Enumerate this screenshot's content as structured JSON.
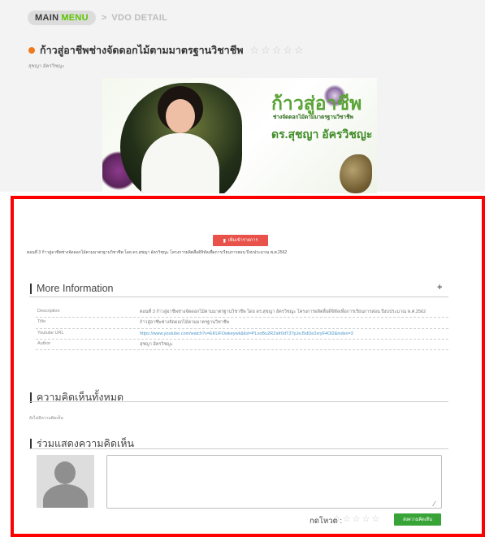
{
  "breadcrumb": {
    "main": "MAIN",
    "menu": "MENU",
    "separator": ">",
    "current": "VDO DETAIL"
  },
  "video": {
    "title": "ก้าวสู่อาชีพช่างจัดดอกไม้ตามมาตรฐานวิชาชีพ",
    "stars": "☆☆☆☆☆",
    "author_sub": "สุชญา อัครวิชญะ"
  },
  "banner": {
    "title": "ก้าวสู่อาชีพ",
    "subtitle": "ช่างจัดดอกไม้ตามมาตรฐานวิชาชีพ",
    "name": "ดร.สุชญา อัครวิชญะ"
  },
  "actions": {
    "bookmark_label": "เพิ่มเข้ารายการ"
  },
  "episode_desc": "ตอนที่ 3 ก้าวสู่อาชีพช่างจัดดอกไม้ตามมาตรฐานวิชาชีพ โดย ดร.สุชญา อัครวิชญะ โครงการผลิตสื่อดิจิทัลเพื่อการเรียนการสอน ปีงบประมาณ พ.ศ.2562",
  "more_info": {
    "heading": "More Information",
    "plus": "+",
    "rows": [
      {
        "key": "Description",
        "value": "ตอนที่ 3 ก้าวสู่อาชีพช่างจัดดอกไม้ตามมาตรฐานวิชาชีพ โดย ดร.สุชญา อัครวิชญะ โครงการผลิตสื่อดิจิทัลเพื่อการเรียนการสอน ปีงบประมาณ พ.ศ.2562"
      },
      {
        "key": "Title",
        "value": "ก้าวสู่อาชีพช่างจัดดอกไม้ตามมาตรฐานวิชาชีพ"
      },
      {
        "key": "Youtube URL",
        "value": "https://www.youtube.com/watch?v=EKUFOwkeywk&list=PLsoBu2RZafr0dT37pJeJ5dDe3xryF4Ol2&index=3"
      },
      {
        "key": "Author",
        "value": "สุชญา อัครวิชญะ"
      }
    ]
  },
  "comments": {
    "heading": "ความคิดเห็นทั้งหมด",
    "empty": "ยังไม่มีความคิดเห็น"
  },
  "comment_form": {
    "heading": "ร่วมแสดงความคิดเห็น",
    "textarea_value": "",
    "rating_label": "กดโหวต :",
    "rating_stars": "☆☆☆☆☆",
    "submit_label": "ส่งความคิดเห็น"
  },
  "colors": {
    "highlight_border": "#ff0000",
    "accent_green": "#5cc400",
    "submit_green": "#38a438",
    "bookmark_red": "#e8524a"
  }
}
